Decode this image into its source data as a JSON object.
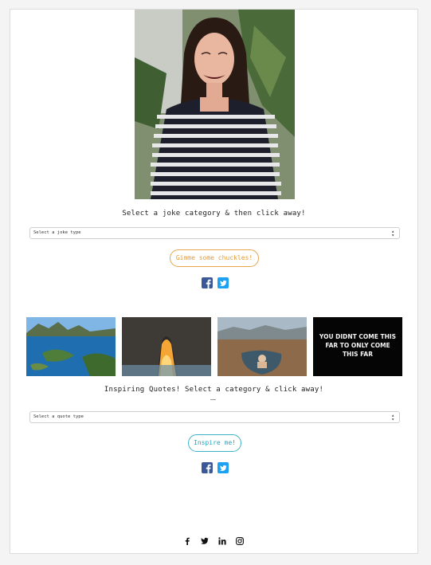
{
  "jokes": {
    "caption": "Select a joke category & then click away!",
    "select_value": "Select a joke type",
    "button_label": "Gimme some chuckles!"
  },
  "quotes": {
    "caption": "Inspiring Quotes! Select a category & click away!",
    "select_value": "Select a quote type",
    "button_label": "Inspire me!",
    "thumbnail_text": "YOU DIDNT COME THIS FAR TO ONLY COME THIS FAR"
  },
  "footer": {
    "icons": [
      "facebook-icon",
      "twitter-icon",
      "linkedin-icon",
      "instagram-icon"
    ]
  },
  "colors": {
    "joke_button": "#e39a35",
    "quote_button": "#29a5bd",
    "facebook": "#3b5998",
    "twitter": "#1da1f2"
  }
}
